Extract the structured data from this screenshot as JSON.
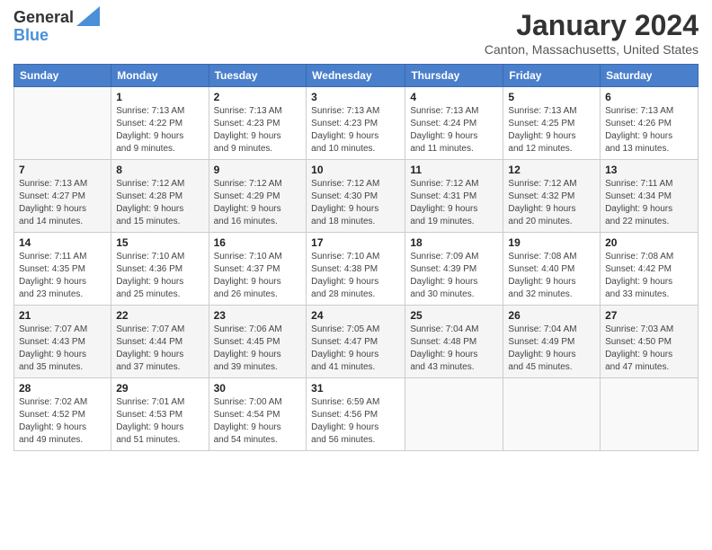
{
  "header": {
    "logo_line1": "General",
    "logo_line2": "Blue",
    "month_title": "January 2024",
    "location": "Canton, Massachusetts, United States"
  },
  "weekdays": [
    "Sunday",
    "Monday",
    "Tuesday",
    "Wednesday",
    "Thursday",
    "Friday",
    "Saturday"
  ],
  "weeks": [
    [
      {
        "day": "",
        "info": ""
      },
      {
        "day": "1",
        "info": "Sunrise: 7:13 AM\nSunset: 4:22 PM\nDaylight: 9 hours\nand 9 minutes."
      },
      {
        "day": "2",
        "info": "Sunrise: 7:13 AM\nSunset: 4:23 PM\nDaylight: 9 hours\nand 9 minutes."
      },
      {
        "day": "3",
        "info": "Sunrise: 7:13 AM\nSunset: 4:23 PM\nDaylight: 9 hours\nand 10 minutes."
      },
      {
        "day": "4",
        "info": "Sunrise: 7:13 AM\nSunset: 4:24 PM\nDaylight: 9 hours\nand 11 minutes."
      },
      {
        "day": "5",
        "info": "Sunrise: 7:13 AM\nSunset: 4:25 PM\nDaylight: 9 hours\nand 12 minutes."
      },
      {
        "day": "6",
        "info": "Sunrise: 7:13 AM\nSunset: 4:26 PM\nDaylight: 9 hours\nand 13 minutes."
      }
    ],
    [
      {
        "day": "7",
        "info": "Sunrise: 7:13 AM\nSunset: 4:27 PM\nDaylight: 9 hours\nand 14 minutes."
      },
      {
        "day": "8",
        "info": "Sunrise: 7:12 AM\nSunset: 4:28 PM\nDaylight: 9 hours\nand 15 minutes."
      },
      {
        "day": "9",
        "info": "Sunrise: 7:12 AM\nSunset: 4:29 PM\nDaylight: 9 hours\nand 16 minutes."
      },
      {
        "day": "10",
        "info": "Sunrise: 7:12 AM\nSunset: 4:30 PM\nDaylight: 9 hours\nand 18 minutes."
      },
      {
        "day": "11",
        "info": "Sunrise: 7:12 AM\nSunset: 4:31 PM\nDaylight: 9 hours\nand 19 minutes."
      },
      {
        "day": "12",
        "info": "Sunrise: 7:12 AM\nSunset: 4:32 PM\nDaylight: 9 hours\nand 20 minutes."
      },
      {
        "day": "13",
        "info": "Sunrise: 7:11 AM\nSunset: 4:34 PM\nDaylight: 9 hours\nand 22 minutes."
      }
    ],
    [
      {
        "day": "14",
        "info": "Sunrise: 7:11 AM\nSunset: 4:35 PM\nDaylight: 9 hours\nand 23 minutes."
      },
      {
        "day": "15",
        "info": "Sunrise: 7:10 AM\nSunset: 4:36 PM\nDaylight: 9 hours\nand 25 minutes."
      },
      {
        "day": "16",
        "info": "Sunrise: 7:10 AM\nSunset: 4:37 PM\nDaylight: 9 hours\nand 26 minutes."
      },
      {
        "day": "17",
        "info": "Sunrise: 7:10 AM\nSunset: 4:38 PM\nDaylight: 9 hours\nand 28 minutes."
      },
      {
        "day": "18",
        "info": "Sunrise: 7:09 AM\nSunset: 4:39 PM\nDaylight: 9 hours\nand 30 minutes."
      },
      {
        "day": "19",
        "info": "Sunrise: 7:08 AM\nSunset: 4:40 PM\nDaylight: 9 hours\nand 32 minutes."
      },
      {
        "day": "20",
        "info": "Sunrise: 7:08 AM\nSunset: 4:42 PM\nDaylight: 9 hours\nand 33 minutes."
      }
    ],
    [
      {
        "day": "21",
        "info": "Sunrise: 7:07 AM\nSunset: 4:43 PM\nDaylight: 9 hours\nand 35 minutes."
      },
      {
        "day": "22",
        "info": "Sunrise: 7:07 AM\nSunset: 4:44 PM\nDaylight: 9 hours\nand 37 minutes."
      },
      {
        "day": "23",
        "info": "Sunrise: 7:06 AM\nSunset: 4:45 PM\nDaylight: 9 hours\nand 39 minutes."
      },
      {
        "day": "24",
        "info": "Sunrise: 7:05 AM\nSunset: 4:47 PM\nDaylight: 9 hours\nand 41 minutes."
      },
      {
        "day": "25",
        "info": "Sunrise: 7:04 AM\nSunset: 4:48 PM\nDaylight: 9 hours\nand 43 minutes."
      },
      {
        "day": "26",
        "info": "Sunrise: 7:04 AM\nSunset: 4:49 PM\nDaylight: 9 hours\nand 45 minutes."
      },
      {
        "day": "27",
        "info": "Sunrise: 7:03 AM\nSunset: 4:50 PM\nDaylight: 9 hours\nand 47 minutes."
      }
    ],
    [
      {
        "day": "28",
        "info": "Sunrise: 7:02 AM\nSunset: 4:52 PM\nDaylight: 9 hours\nand 49 minutes."
      },
      {
        "day": "29",
        "info": "Sunrise: 7:01 AM\nSunset: 4:53 PM\nDaylight: 9 hours\nand 51 minutes."
      },
      {
        "day": "30",
        "info": "Sunrise: 7:00 AM\nSunset: 4:54 PM\nDaylight: 9 hours\nand 54 minutes."
      },
      {
        "day": "31",
        "info": "Sunrise: 6:59 AM\nSunset: 4:56 PM\nDaylight: 9 hours\nand 56 minutes."
      },
      {
        "day": "",
        "info": ""
      },
      {
        "day": "",
        "info": ""
      },
      {
        "day": "",
        "info": ""
      }
    ]
  ]
}
